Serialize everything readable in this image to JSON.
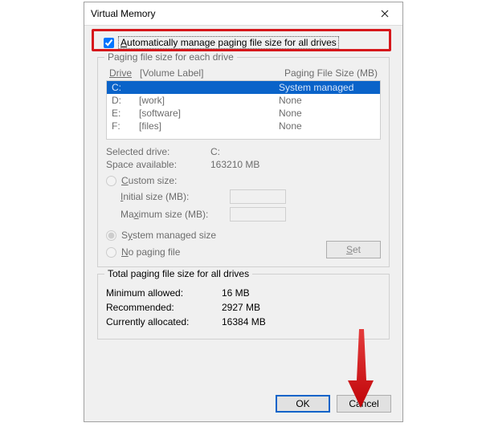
{
  "window": {
    "title": "Virtual Memory"
  },
  "auto_manage": {
    "label": "Automatically manage paging file size for all drives",
    "checked": true
  },
  "group_drives": {
    "legend": "Paging file size for each drive",
    "header_drive": "Drive",
    "header_volume": "[Volume Label]",
    "header_size": "Paging File Size (MB)",
    "rows": [
      {
        "letter": "C:",
        "label": "",
        "size": "System managed",
        "selected": true
      },
      {
        "letter": "D:",
        "label": "[work]",
        "size": "None",
        "selected": false
      },
      {
        "letter": "E:",
        "label": "[software]",
        "size": "None",
        "selected": false
      },
      {
        "letter": "F:",
        "label": "[files]",
        "size": "None",
        "selected": false
      }
    ],
    "selected_drive_label": "Selected drive:",
    "selected_drive_value": "C:",
    "space_label": "Space available:",
    "space_value": "163210 MB",
    "custom_size_label": "Custom size:",
    "initial_label": "Initial size (MB):",
    "maximum_label": "Maximum size (MB):",
    "system_managed_label": "System managed size",
    "no_paging_label": "No paging file",
    "set_label": "Set"
  },
  "group_totals": {
    "legend": "Total paging file size for all drives",
    "min_label": "Minimum allowed:",
    "min_value": "16 MB",
    "rec_label": "Recommended:",
    "rec_value": "2927 MB",
    "cur_label": "Currently allocated:",
    "cur_value": "16384 MB"
  },
  "buttons": {
    "ok": "OK",
    "cancel": "Cancel"
  },
  "colors": {
    "highlight": "#d6171b",
    "selection": "#0a63c9"
  }
}
